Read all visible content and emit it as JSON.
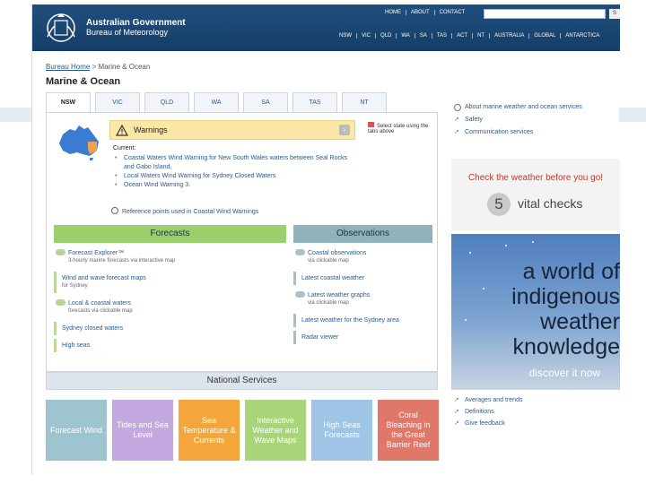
{
  "header": {
    "gov_line1": "Australian Government",
    "gov_line2": "Bureau of Meteorology",
    "top_links": [
      "HOME",
      "ABOUT",
      "CONTACT"
    ],
    "search_button": "S",
    "state_nav": [
      "NSW",
      "VIC",
      "QLD",
      "WA",
      "SA",
      "TAS",
      "ACT",
      "NT",
      "AUSTRALIA",
      "GLOBAL",
      "ANTARCTICA"
    ]
  },
  "breadcrumb": {
    "home": "Bureau Home",
    "sep": " > ",
    "current": "Marine & Ocean"
  },
  "page_title": "Marine & Ocean",
  "tabs": [
    "NSW",
    "VIC",
    "QLD",
    "WA",
    "SA",
    "TAS",
    "NT"
  ],
  "warnings": {
    "title": "Warnings",
    "select_note": "Select state using the tabs above",
    "current_label": "Current:",
    "items": [
      "Coastal Waters Wind Warning for New South Wales waters between Seal Rocks and Gabo Island,",
      "Local Waters Wind Warning for Sydney Closed Waters",
      "Ocean Wind Warning 3."
    ],
    "reference_points": "Reference points used in Coastal Wind Warnings"
  },
  "forecasts": {
    "heading": "Forecasts",
    "items": [
      {
        "label": "Forecast Explorer™",
        "sub": "3-hourly marine forecasts via interactive map",
        "icon": true
      },
      {
        "label": "Wind and wave forecast maps",
        "sub": "for Sydney",
        "icon": false
      },
      {
        "label": "Local & coastal waters",
        "sub": "forecasts via clickable map",
        "icon": true
      },
      {
        "label": "Sydney closed waters",
        "sub": "",
        "icon": false
      },
      {
        "label": "High seas",
        "sub": "",
        "icon": false
      }
    ]
  },
  "observations": {
    "heading": "Observations",
    "items": [
      {
        "label": "Coastal observations",
        "sub": "via clickable map",
        "icon": true
      },
      {
        "label": "Latest coastal weather",
        "sub": "",
        "icon": false
      },
      {
        "label": "Latest weather graphs",
        "sub": "via clickable map",
        "icon": true
      },
      {
        "label": "Latest weather for the Sydney area",
        "sub": "",
        "icon": false
      },
      {
        "label": "Radar viewer",
        "sub": "",
        "icon": false
      }
    ]
  },
  "national_services": {
    "heading": "National Services",
    "tiles": [
      {
        "label": "Forecast Wind",
        "color": "#9ec5cf"
      },
      {
        "label": "Tides and Sea Level",
        "color": "#c3a9df"
      },
      {
        "label": "Sea Temperature & Currents",
        "color": "#f5a63a"
      },
      {
        "label": "Interactive Weather and Wave Maps",
        "color": "#a9d57a"
      },
      {
        "label": "High Seas Forecasts",
        "color": "#9ec5e6"
      },
      {
        "label": "Coral Bleaching in the Great Barrier Reef",
        "color": "#e0786a"
      }
    ]
  },
  "sidebar": {
    "links_top": [
      "About marine weather and ocean services",
      "Safety",
      "Communication services"
    ],
    "checks_heading": "Check the weather before you go!",
    "checks_number": "5",
    "checks_text": "vital checks",
    "banner_lines": [
      "a world of",
      "indigenous",
      "weather",
      "knowledge"
    ],
    "banner_cta": "discover it now",
    "links_bottom": [
      "Averages and trends",
      "Definitions",
      "Give feedback"
    ]
  }
}
